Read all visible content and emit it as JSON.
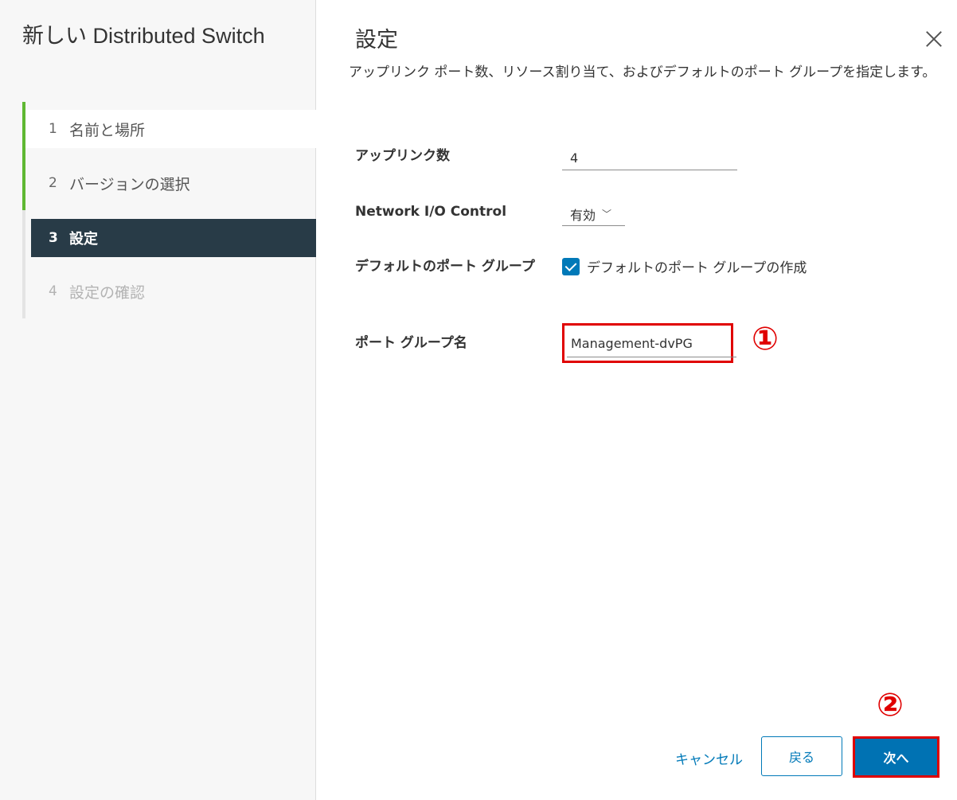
{
  "wizard": {
    "title": "新しい Distributed Switch",
    "steps": [
      {
        "num": "1",
        "label": "名前と場所",
        "state": "done"
      },
      {
        "num": "2",
        "label": "バージョンの選択",
        "state": "done"
      },
      {
        "num": "3",
        "label": "設定",
        "state": "active"
      },
      {
        "num": "4",
        "label": "設定の確認",
        "state": "future"
      }
    ]
  },
  "page": {
    "title": "設定",
    "description": "アップリンク ポート数、リソース割り当て、およびデフォルトのポート グループを指定します。"
  },
  "form": {
    "uplinks_label": "アップリンク数",
    "uplinks_value": "4",
    "nioc_label": "Network I/O Control",
    "nioc_value": "有効",
    "default_pg_label": "デフォルトのポート グループ",
    "default_pg_checkbox_label": "デフォルトのポート グループの作成",
    "default_pg_checked": true,
    "pg_name_label": "ポート グループ名",
    "pg_name_value": "Management-dvPG"
  },
  "annotations": {
    "marker1": "①",
    "marker2": "②",
    "highlight_color": "#e00000"
  },
  "footer": {
    "cancel_label": "キャンセル",
    "back_label": "戻る",
    "next_label": "次へ"
  },
  "colors": {
    "accent": "#0079b8",
    "done_rail": "#5fb832",
    "active_step_bg": "#283b47"
  }
}
